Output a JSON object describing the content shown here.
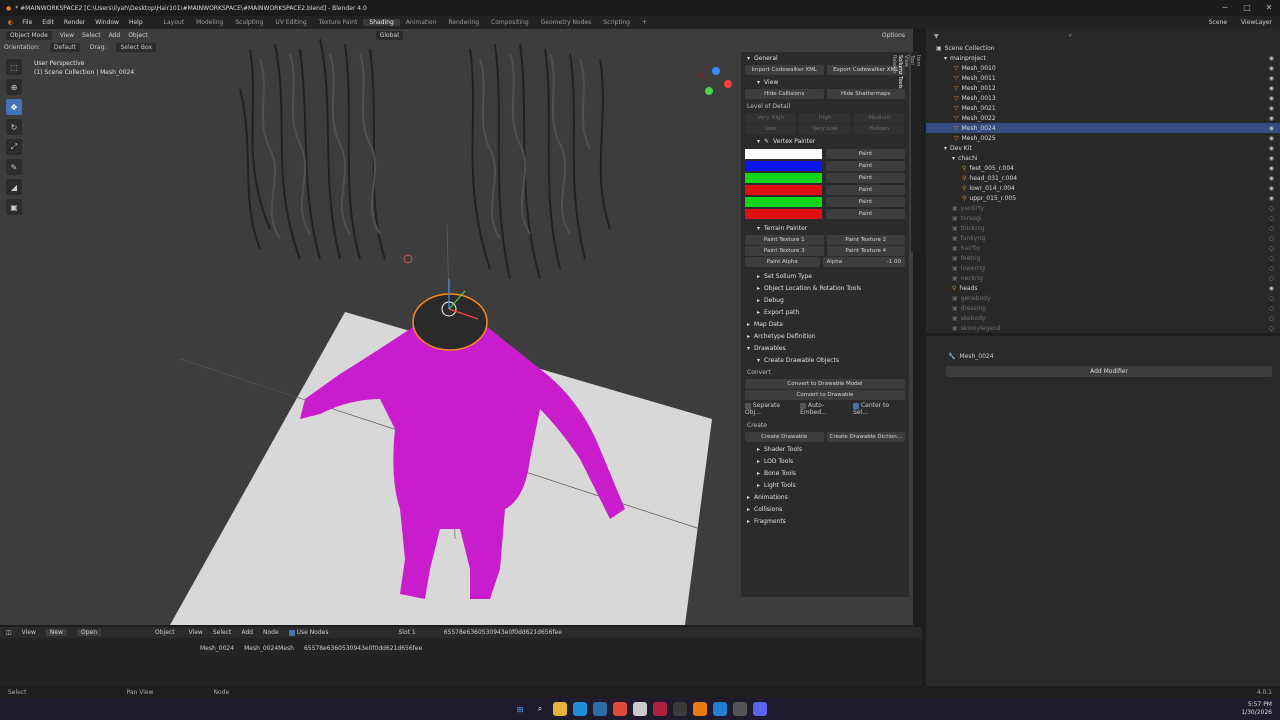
{
  "window": {
    "title": "* #MAINWORKSPACE2 [C:\\Users\\ilyah\\Desktop\\Hair101\\#MAINWORKSPACE\\#MAINWORKSPACE2.blend] - Blender 4.0"
  },
  "menu": {
    "items": [
      "File",
      "Edit",
      "Render",
      "Window",
      "Help"
    ],
    "workspaces": [
      "Layout",
      "Modeling",
      "Sculpting",
      "UV Editing",
      "Texture Paint",
      "Shading",
      "Animation",
      "Rendering",
      "Compositing",
      "Geometry Nodes",
      "Scripting"
    ],
    "active_workspace": "Shading",
    "scene": "Scene",
    "view_layer": "ViewLayer"
  },
  "viewport": {
    "mode": "Object Mode",
    "menus": [
      "View",
      "Select",
      "Add",
      "Object"
    ],
    "orientation_label": "Orientation:",
    "orientation_value": "Default",
    "drag_label": "Drag:",
    "drag_value": "Select Box",
    "transform": "Global",
    "options": "Options",
    "perspective": "User Perspective",
    "collection": "(1) Scene Collection | Mesh_0024"
  },
  "npanel": {
    "general": "General",
    "import_xml": "Import Codewalker XML",
    "export_xml": "Export Codewalker XML",
    "view": "View",
    "hide_collisions": "Hide Collisions",
    "hide_shattermaps": "Hide Shattermaps",
    "lod_label": "Level of Detail",
    "lod": [
      "Very High",
      "High",
      "Medium",
      "Low",
      "Very Low",
      "Hidden"
    ],
    "vertex_painter": "Vertex Painter",
    "paint": "Paint",
    "swatches": [
      "#ffffff",
      "#0a14f0",
      "#12d41a",
      "#e01010",
      "#12d41a",
      "#e01010"
    ],
    "terrain_painter": "Terrain Painter",
    "paint_textures": [
      "Paint Texture 1",
      "Paint Texture 2",
      "Paint Texture 3",
      "Paint Texture 4"
    ],
    "paint_alpha": "Paint Alpha",
    "alpha_label": "Alpha",
    "alpha_value": "-1.00",
    "set_collision_type": "Set Sollum Type",
    "obj_location": "Object Location & Rotation Tools",
    "debug": "Debug",
    "export_path": "Export path",
    "map_data": "Map Data",
    "archetype": "Archetype Definition",
    "drawables": "Drawables",
    "create_drawable_objects": "Create Drawable Objects",
    "convert": "Convert",
    "convert_model": "Convert to Drawable Model",
    "convert_drawable": "Convert to Drawable",
    "separate_obj": "Separate Obj...",
    "auto_embed": "Auto-Embed...",
    "center_to_sel": "Center to Sel...",
    "create": "Create",
    "create_drawable": "Create Drawable",
    "create_dictionary": "Create Drawable Diction...",
    "shader_tools": "Shader Tools",
    "lod_tools": "LOD Tools",
    "bone_tools": "Bone Tools",
    "light_tools": "Light Tools",
    "animations": "Animations",
    "collisions": "Collisions",
    "fragments": "Fragments",
    "tabs": [
      "Item",
      "Tool",
      "View",
      "Sollumz Tools",
      "Rokoko"
    ]
  },
  "outliner": {
    "root": "Scene Collection",
    "main": "mainproject",
    "meshes": [
      "Mesh_0010",
      "Mesh_0011",
      "Mesh_0012",
      "Mesh_0013",
      "Mesh_0021",
      "Mesh_0022",
      "Mesh_0024",
      "Mesh_0025"
    ],
    "selected": "Mesh_0024",
    "devkit": "Dev Kit",
    "chachi": "chachi",
    "parts": [
      "feet_005_r.004",
      "head_031_r.004",
      "lowr_014_r.004",
      "uppr_015_r.005"
    ],
    "dimmed": [
      "yardirty",
      "torsogi",
      "thicknig",
      "funkyrig",
      "hairfig",
      "feetrig",
      "lowerrig",
      "neckrig"
    ],
    "heads": "heads",
    "dimmed2": [
      "genebody",
      "dressing",
      "skebody",
      "skinnylegend"
    ]
  },
  "properties": {
    "object": "Mesh_0024",
    "add_modifier": "Add Modifier"
  },
  "shader": {
    "menus": [
      "View",
      "Select",
      "Add",
      "Node"
    ],
    "new": "New",
    "open": "Open",
    "object": "Object",
    "use_nodes": "Use Nodes",
    "slot": "Slot 1",
    "material": "65578e6360530943e0f0dd621d656fee",
    "breadcrumb": [
      "Mesh_0024",
      "Mesh_0024Mesh",
      "65578e6360530943e0f0dd621d656fee"
    ]
  },
  "status": {
    "left": "Select",
    "middle": "Pan View",
    "right": "Node",
    "version": "4.0.1"
  },
  "clock": {
    "time": "5:57 PM",
    "date": "1/30/2026"
  }
}
